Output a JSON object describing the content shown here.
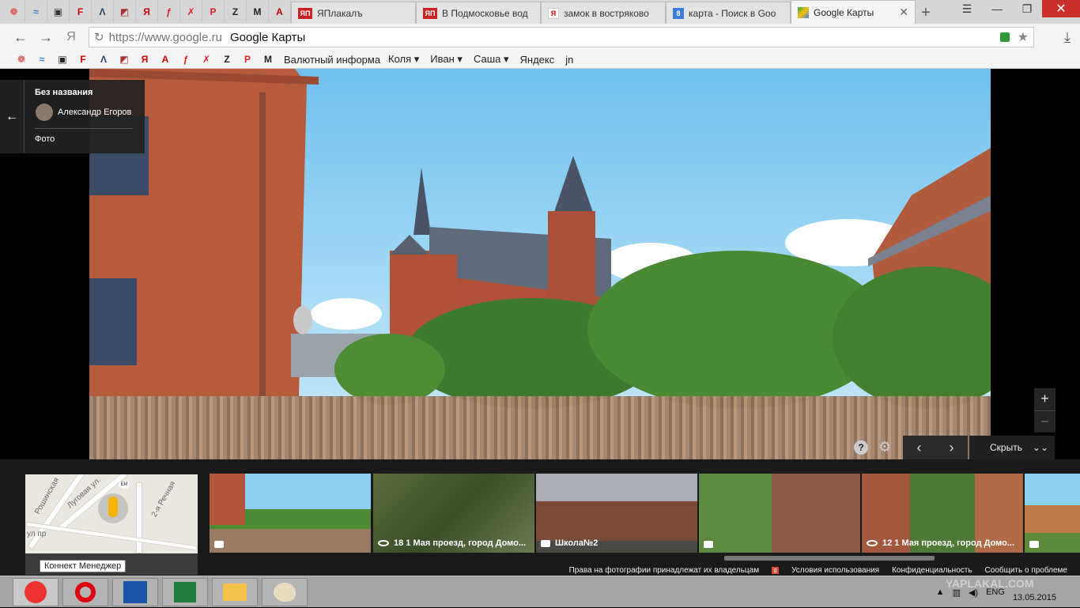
{
  "tabs": [
    {
      "label": "ЯПлакалъ",
      "favicon": "ЯП"
    },
    {
      "label": "В Подмосковье вод",
      "favicon": "ЯП"
    },
    {
      "label": "замок в востряково",
      "favicon": "Я"
    },
    {
      "label": "карта - Поиск в Goo",
      "favicon": "8"
    },
    {
      "label": "Google Карты",
      "favicon": "map"
    }
  ],
  "address": {
    "url": "https://www.google.ru",
    "page_title": "Google Карты"
  },
  "bookmarks": [
    "Валютный информа",
    "Коля ▾",
    "Иван ▾",
    "Саша ▾",
    "Яндекс",
    "jn"
  ],
  "card": {
    "title": "Без названия",
    "author": "Александр Егоров",
    "label": "Фото"
  },
  "controls": {
    "zoom_in": "+",
    "zoom_out": "−",
    "help": "?",
    "hide_label": "Скрыть"
  },
  "minimap": {
    "road1": "Рошинская",
    "road2": "Луговая ул.",
    "road3": "2-я Речная",
    "road4": "ул пр",
    "badge": "EM"
  },
  "tooltip": "Коннект Менеджер",
  "thumbnails": [
    {
      "caption": "",
      "icon": "camera-icon"
    },
    {
      "caption": "18 1 Мая проезд, город Домо...",
      "icon": "panorama-icon"
    },
    {
      "caption": "Школа№2",
      "icon": "camera-icon"
    },
    {
      "caption": "",
      "icon": "camera-icon"
    },
    {
      "caption": "12 1 Мая проезд, город Домо...",
      "icon": "panorama-icon"
    },
    {
      "caption": "",
      "icon": "camera-icon"
    }
  ],
  "footer": {
    "rights": "Права на фотографии принадлежат их владельцам",
    "terms": "Условия использования",
    "privacy": "Конфиденциальность",
    "report": "Сообщить о проблеме"
  },
  "tray": {
    "lang": "ENG",
    "date": "13.05.2015"
  },
  "watermark": "YAPLAKAL.COM"
}
